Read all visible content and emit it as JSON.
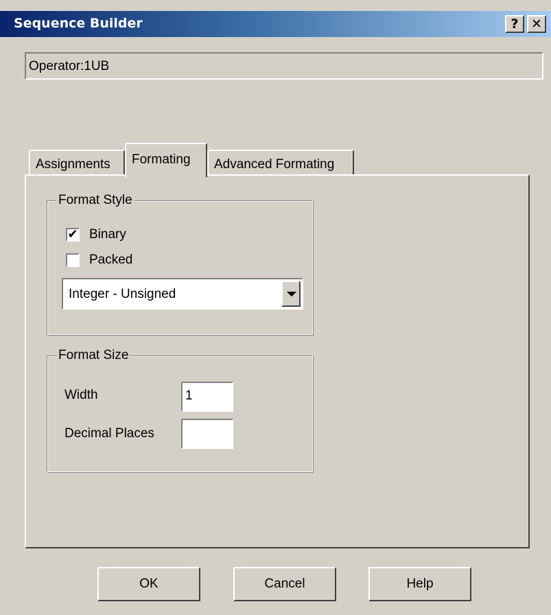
{
  "window": {
    "title": "Sequence Builder",
    "help_button": "?",
    "close_button": "✕"
  },
  "operator_field": "Operator:1UB",
  "tabs": [
    {
      "label": "Assignments",
      "selected": false
    },
    {
      "label": "Formating",
      "selected": true
    },
    {
      "label": "Advanced Formating",
      "selected": false
    }
  ],
  "format_style": {
    "legend": "Format Style",
    "binary": {
      "label": "Binary",
      "checked": true,
      "mark": "✔"
    },
    "packed": {
      "label": "Packed",
      "checked": false,
      "mark": ""
    },
    "type_select": {
      "value": "Integer - Unsigned"
    }
  },
  "format_size": {
    "legend": "Format Size",
    "width_label": "Width",
    "width_value": "1",
    "decimal_label": "Decimal Places",
    "decimal_value": ""
  },
  "buttons": {
    "ok": "OK",
    "cancel": "Cancel",
    "help": "Help"
  }
}
